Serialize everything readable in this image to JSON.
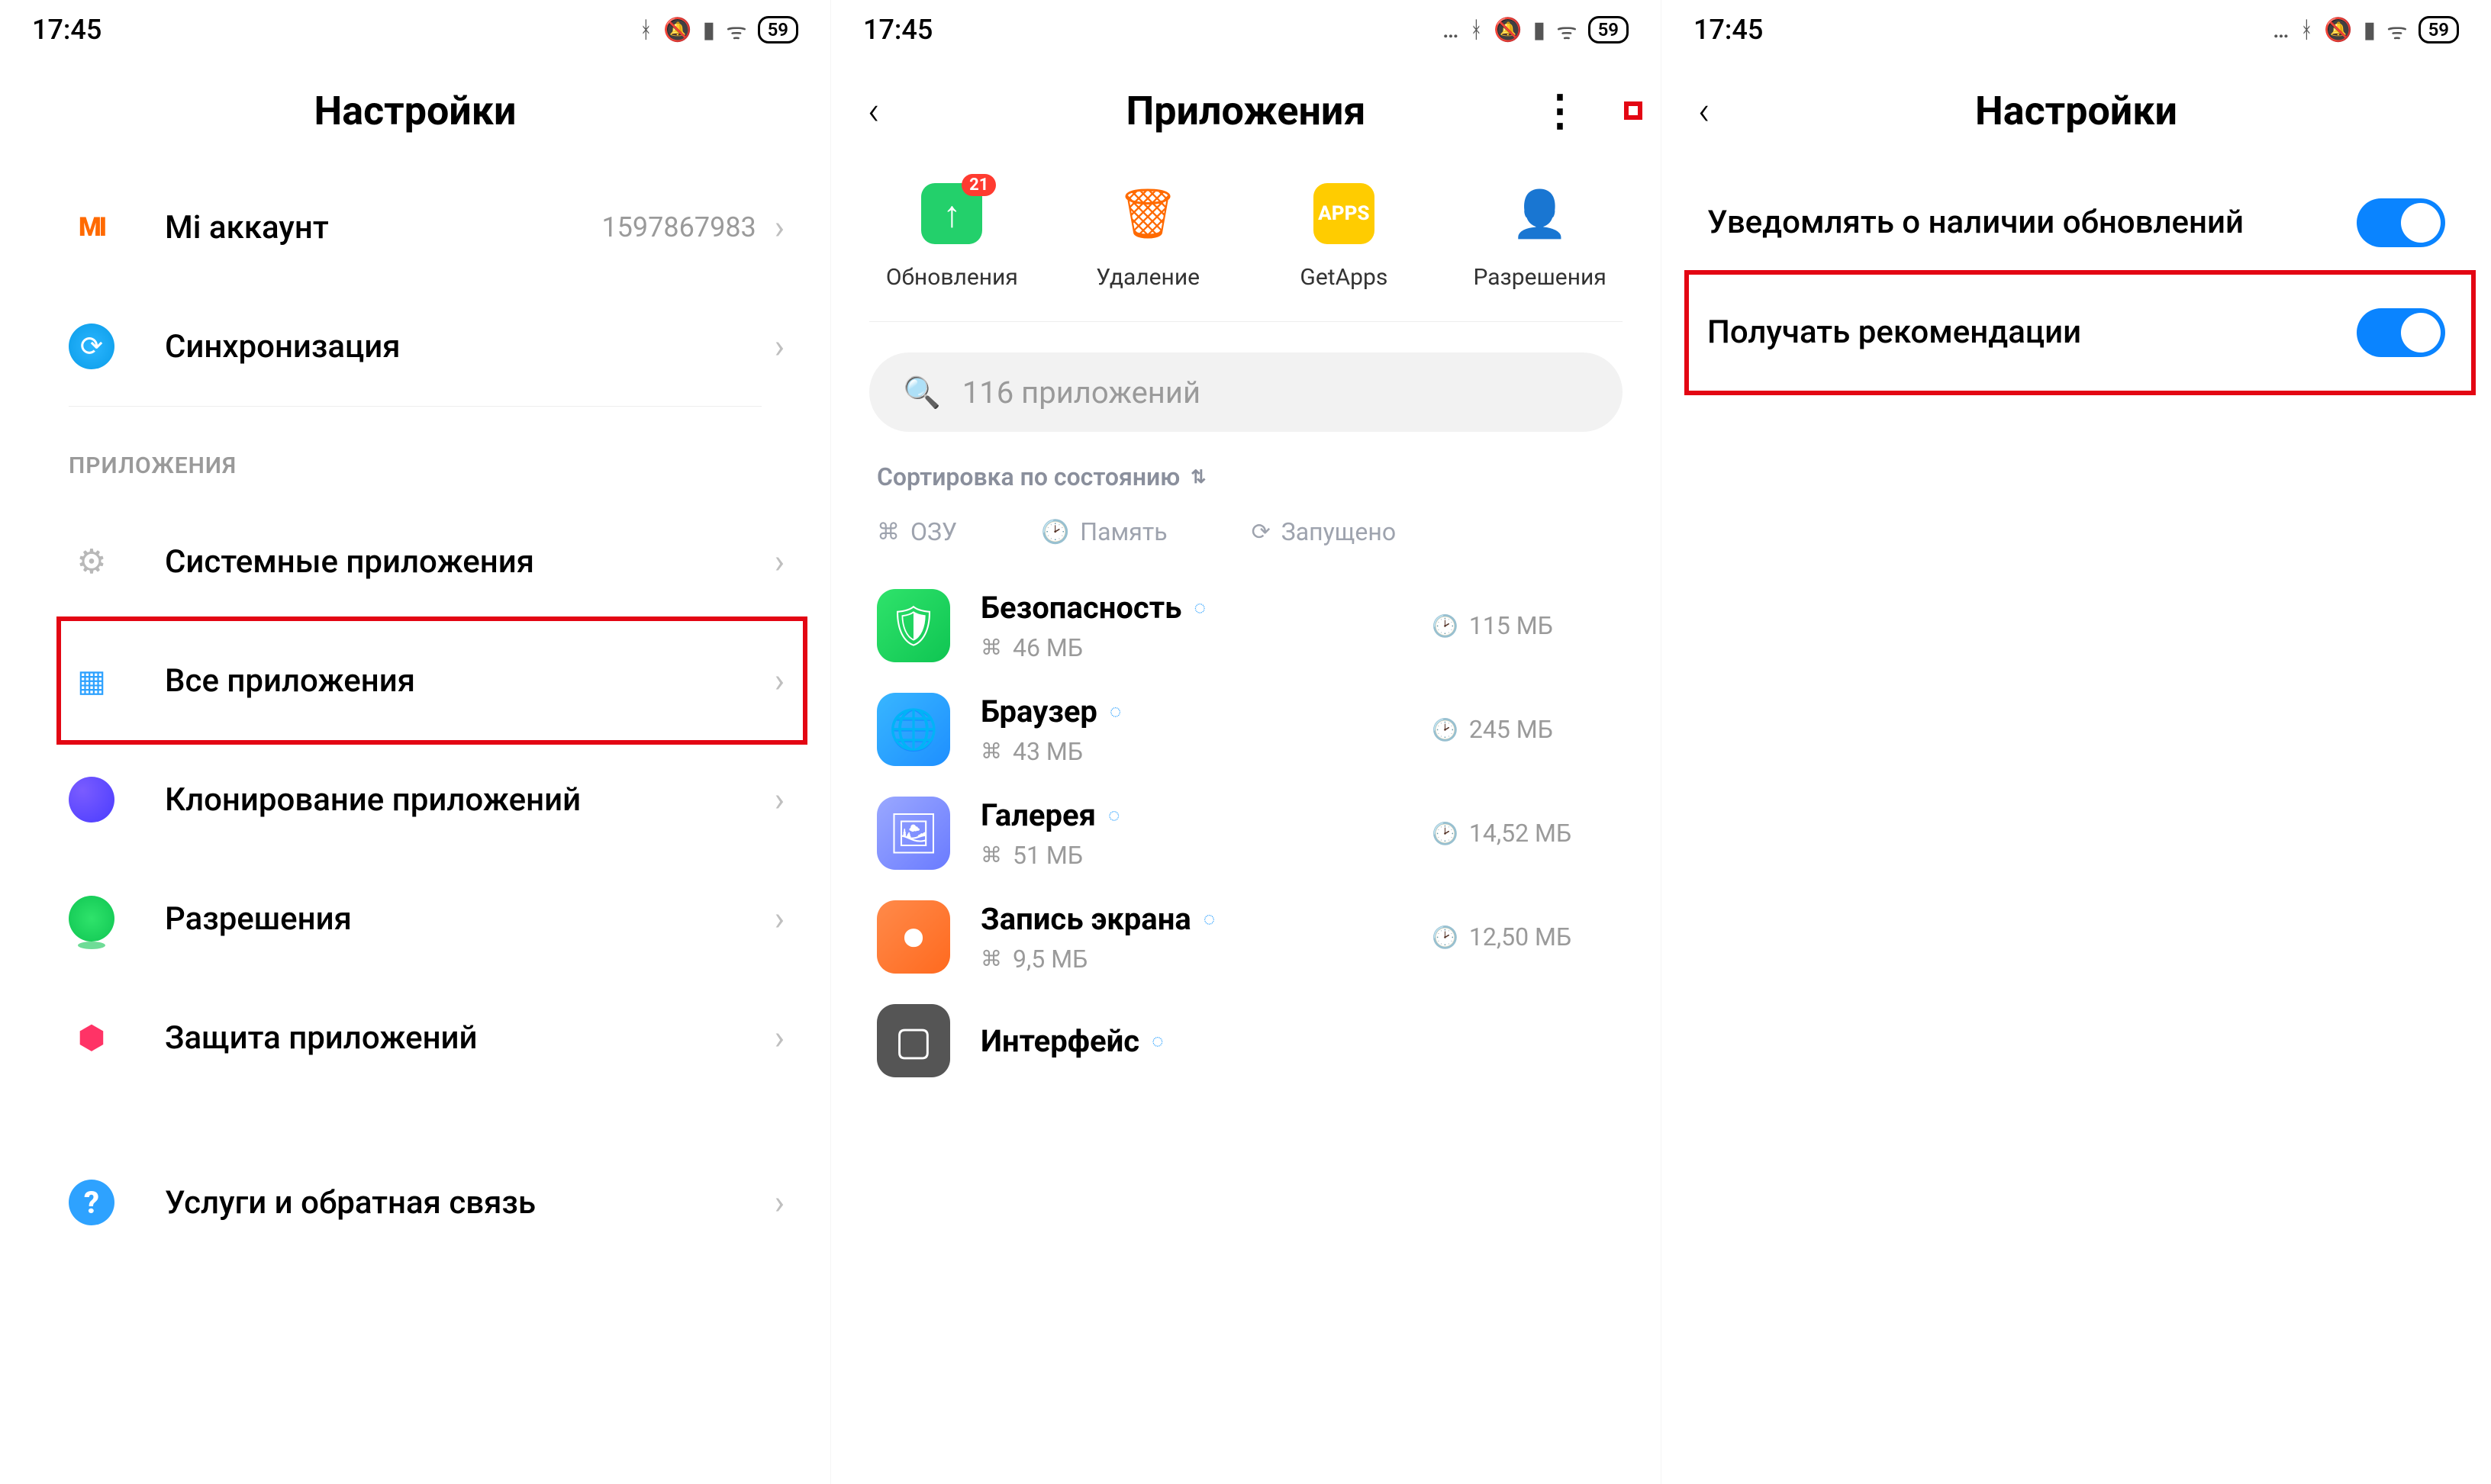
{
  "status": {
    "time": "17:45",
    "battery": "59"
  },
  "panel1": {
    "title": "Настройки",
    "account": {
      "label": "Mi аккаунт",
      "value": "1597867983"
    },
    "sync_label": "Синхронизация",
    "section_apps": "ПРИЛОЖЕНИЯ",
    "items": {
      "system": "Системные приложения",
      "all": "Все приложения",
      "clone": "Клонирование приложений",
      "perm": "Разрешения",
      "protect": "Защита приложений",
      "help": "Услуги и обратная связь"
    }
  },
  "panel2": {
    "title": "Приложения",
    "quick": {
      "updates": "Обновления",
      "updates_badge": "21",
      "delete": "Удаление",
      "getapps": "GetApps",
      "perm": "Разрешения"
    },
    "search_placeholder": "116 приложений",
    "sort_label": "Сортировка по состоянию",
    "chips": {
      "ram": "ОЗУ",
      "storage": "Память",
      "running": "Запущено"
    },
    "apps": [
      {
        "name": "Безопасность",
        "ram": "46 МБ",
        "storage": "115 МБ",
        "icon": "ai-sec",
        "glyph": "🛡"
      },
      {
        "name": "Браузер",
        "ram": "43 МБ",
        "storage": "245 МБ",
        "icon": "ai-brw",
        "glyph": "🌐"
      },
      {
        "name": "Галерея",
        "ram": "51 МБ",
        "storage": "14,52 МБ",
        "icon": "ai-gal",
        "glyph": "🖼"
      },
      {
        "name": "Запись экрана",
        "ram": "9,5 МБ",
        "storage": "12,50 МБ",
        "icon": "ai-rec",
        "glyph": "⏺"
      },
      {
        "name": "Интерфейс",
        "ram": "",
        "storage": "",
        "icon": "ai-int",
        "glyph": "▢"
      }
    ]
  },
  "panel3": {
    "title": "Настройки",
    "toggles": {
      "notify_updates": "Уведомлять о наличии обновлений",
      "recommendations": "Получать рекомендации"
    }
  }
}
